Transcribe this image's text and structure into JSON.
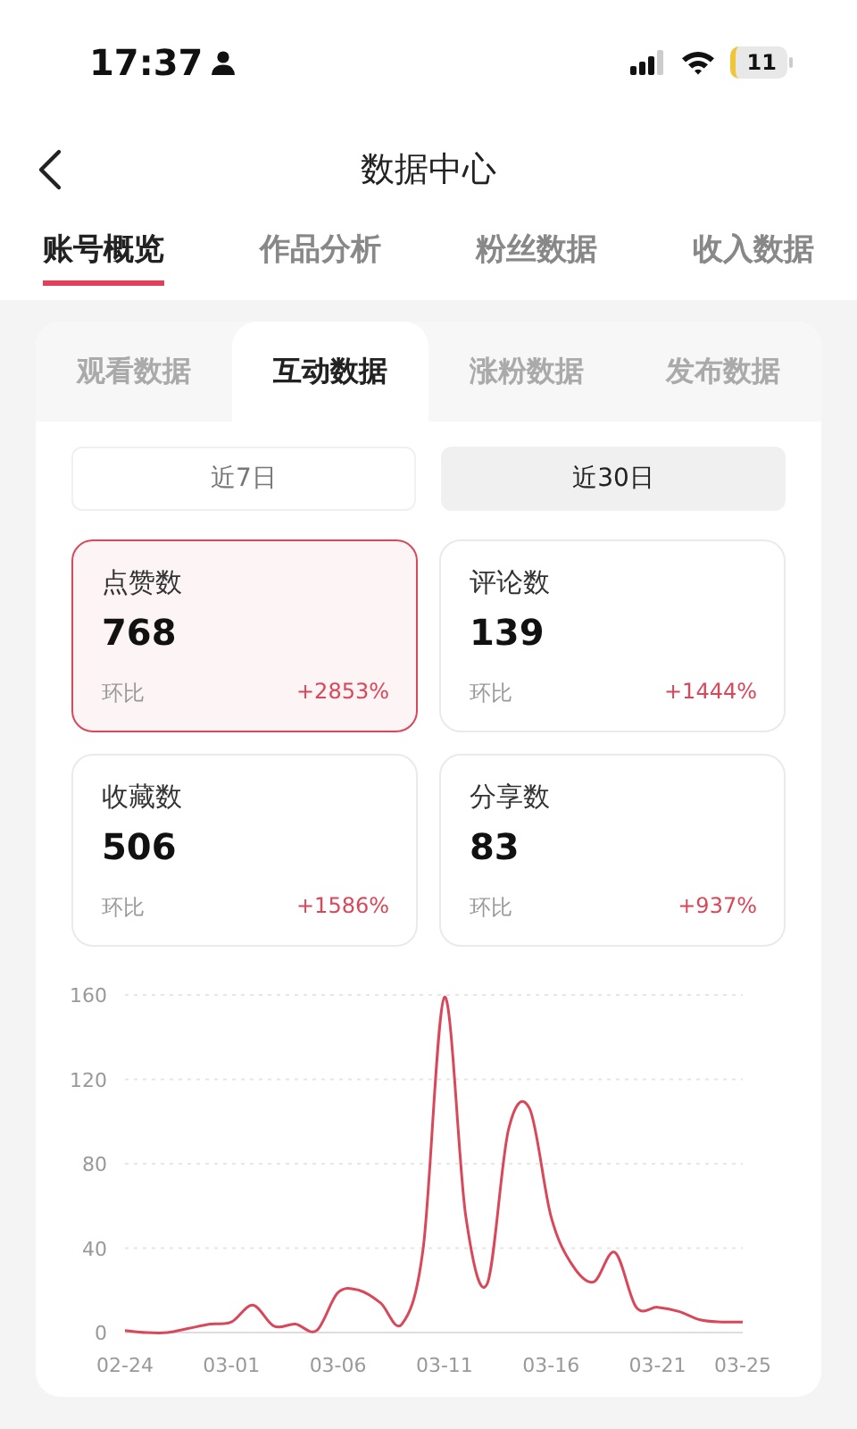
{
  "status_bar": {
    "time": "17:37",
    "battery": "11"
  },
  "nav": {
    "title": "数据中心"
  },
  "tabs": [
    {
      "label": "账号概览",
      "selected": true
    },
    {
      "label": "作品分析",
      "selected": false
    },
    {
      "label": "粉丝数据",
      "selected": false
    },
    {
      "label": "收入数据",
      "selected": false
    }
  ],
  "sub_tabs": [
    {
      "label": "观看数据",
      "selected": false
    },
    {
      "label": "互动数据",
      "selected": true
    },
    {
      "label": "涨粉数据",
      "selected": false
    },
    {
      "label": "发布数据",
      "selected": false
    }
  ],
  "ranges": [
    {
      "label": "近7日",
      "selected": false
    },
    {
      "label": "近30日",
      "selected": true
    }
  ],
  "metrics": [
    {
      "name": "点赞数",
      "value": "768",
      "compare_label": "环比",
      "change": "+2853%",
      "selected": true
    },
    {
      "name": "评论数",
      "value": "139",
      "compare_label": "环比",
      "change": "+1444%",
      "selected": false
    },
    {
      "name": "收藏数",
      "value": "506",
      "compare_label": "环比",
      "change": "+1586%",
      "selected": false
    },
    {
      "name": "分享数",
      "value": "83",
      "compare_label": "环比",
      "change": "+937%",
      "selected": false
    }
  ],
  "chart": {
    "chart_data": {
      "type": "line",
      "categories": [
        "02-24",
        null,
        null,
        null,
        null,
        "03-01",
        null,
        null,
        null,
        null,
        "03-06",
        null,
        null,
        null,
        null,
        "03-11",
        null,
        null,
        null,
        null,
        "03-16",
        null,
        null,
        null,
        null,
        "03-21",
        null,
        null,
        null,
        "03-25"
      ],
      "series": [
        {
          "color": "#d9485a",
          "values": [
            1,
            0,
            0,
            2,
            4,
            5,
            13,
            3,
            4,
            1,
            19,
            20,
            14,
            4,
            40,
            159,
            55,
            23,
            96,
            106,
            55,
            32,
            24,
            38,
            12,
            12,
            10,
            6,
            5,
            5
          ]
        }
      ],
      "ylim": [
        0,
        160
      ],
      "grid": true,
      "yticks": [
        0,
        40,
        80,
        120,
        160
      ]
    }
  }
}
